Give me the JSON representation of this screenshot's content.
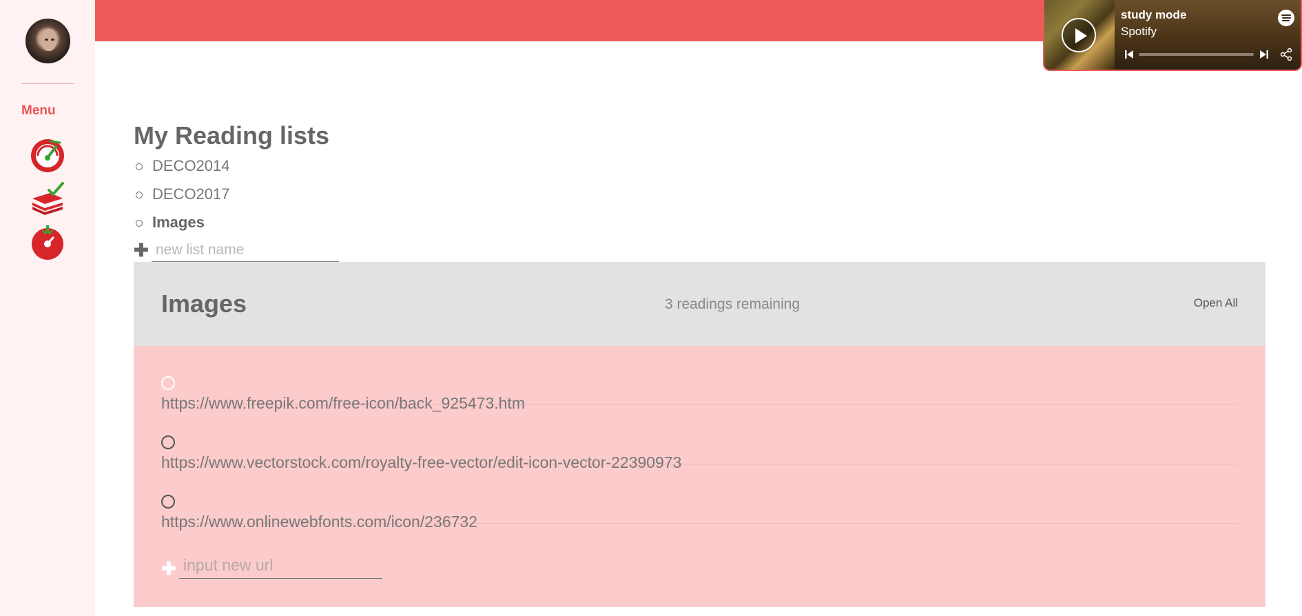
{
  "sidebar": {
    "menu_label": "Menu",
    "icons": [
      "speedometer-icon",
      "books-check-icon",
      "tomato-timer-icon"
    ]
  },
  "spotify": {
    "title": "study mode",
    "subtitle": "Spotify",
    "brand_color": "#ec5a59"
  },
  "reading_lists": {
    "title": "My Reading lists",
    "items": [
      "DECO2014",
      "DECO2017",
      "Images"
    ],
    "active": "Images",
    "new_list_placeholder": "new list name"
  },
  "panel": {
    "title": "Images",
    "remaining": "3 readings remaining",
    "open_all_label": "Open All",
    "urls": [
      "https://www.freepik.com/free-icon/back_925473.htm",
      "https://www.vectorstock.com/royalty-free-vector/edit-icon-vector-22390973",
      "https://www.onlinewebfonts.com/icon/236732"
    ],
    "new_url_placeholder": "input new url"
  },
  "colors": {
    "accent": "#ec5a59",
    "panel_head": "#e2e2e2",
    "panel_body": "#fccbcb",
    "sidebar": "#fff2f2"
  }
}
